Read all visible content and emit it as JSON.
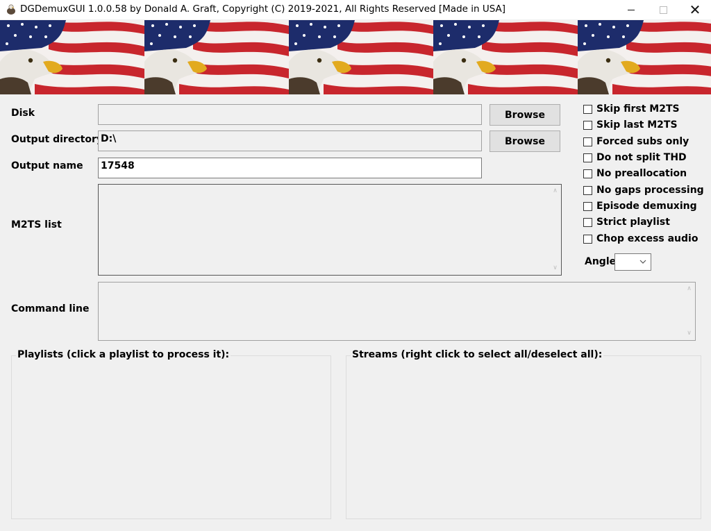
{
  "window": {
    "title": "DGDemuxGUI 1.0.0.58 by Donald A. Graft, Copyright (C) 2019-2021, All Rights Reserved [Made in USA]",
    "icon": "eagle-app-icon",
    "controls": {
      "minimize": "minimize-icon",
      "maximize": "maximize-icon",
      "close": "✕"
    }
  },
  "banner": {
    "tiles": 5,
    "image": "eagle-and-american-flag"
  },
  "form": {
    "disk": {
      "label": "Disk",
      "value": ""
    },
    "output_dir": {
      "label": "Output directory",
      "value": "D:\\"
    },
    "output_name": {
      "label": "Output name",
      "value": "17548"
    },
    "m2ts_list": {
      "label": "M2TS list"
    },
    "command_line": {
      "label": "Command line"
    },
    "browse_label": "Browse"
  },
  "options": {
    "checkboxes": [
      {
        "label": "Skip first M2TS",
        "checked": false
      },
      {
        "label": "Skip last M2TS",
        "checked": false
      },
      {
        "label": "Forced subs only",
        "checked": false
      },
      {
        "label": "Do not split THD",
        "checked": false
      },
      {
        "label": "No preallocation",
        "checked": false
      },
      {
        "label": "No gaps processing",
        "checked": false
      },
      {
        "label": "Episode demuxing",
        "checked": false
      },
      {
        "label": "Strict playlist",
        "checked": false
      },
      {
        "label": "Chop excess audio",
        "checked": false
      }
    ],
    "angle": {
      "label": "Angle",
      "value": ""
    }
  },
  "groups": {
    "playlists": "Playlists (click a playlist to process it):",
    "streams": "Streams (right click to select all/deselect all):"
  },
  "colors": {
    "flag_red": "#c8262d",
    "flag_blue": "#1d2c6b",
    "window_bg": "#f0f0f0"
  }
}
